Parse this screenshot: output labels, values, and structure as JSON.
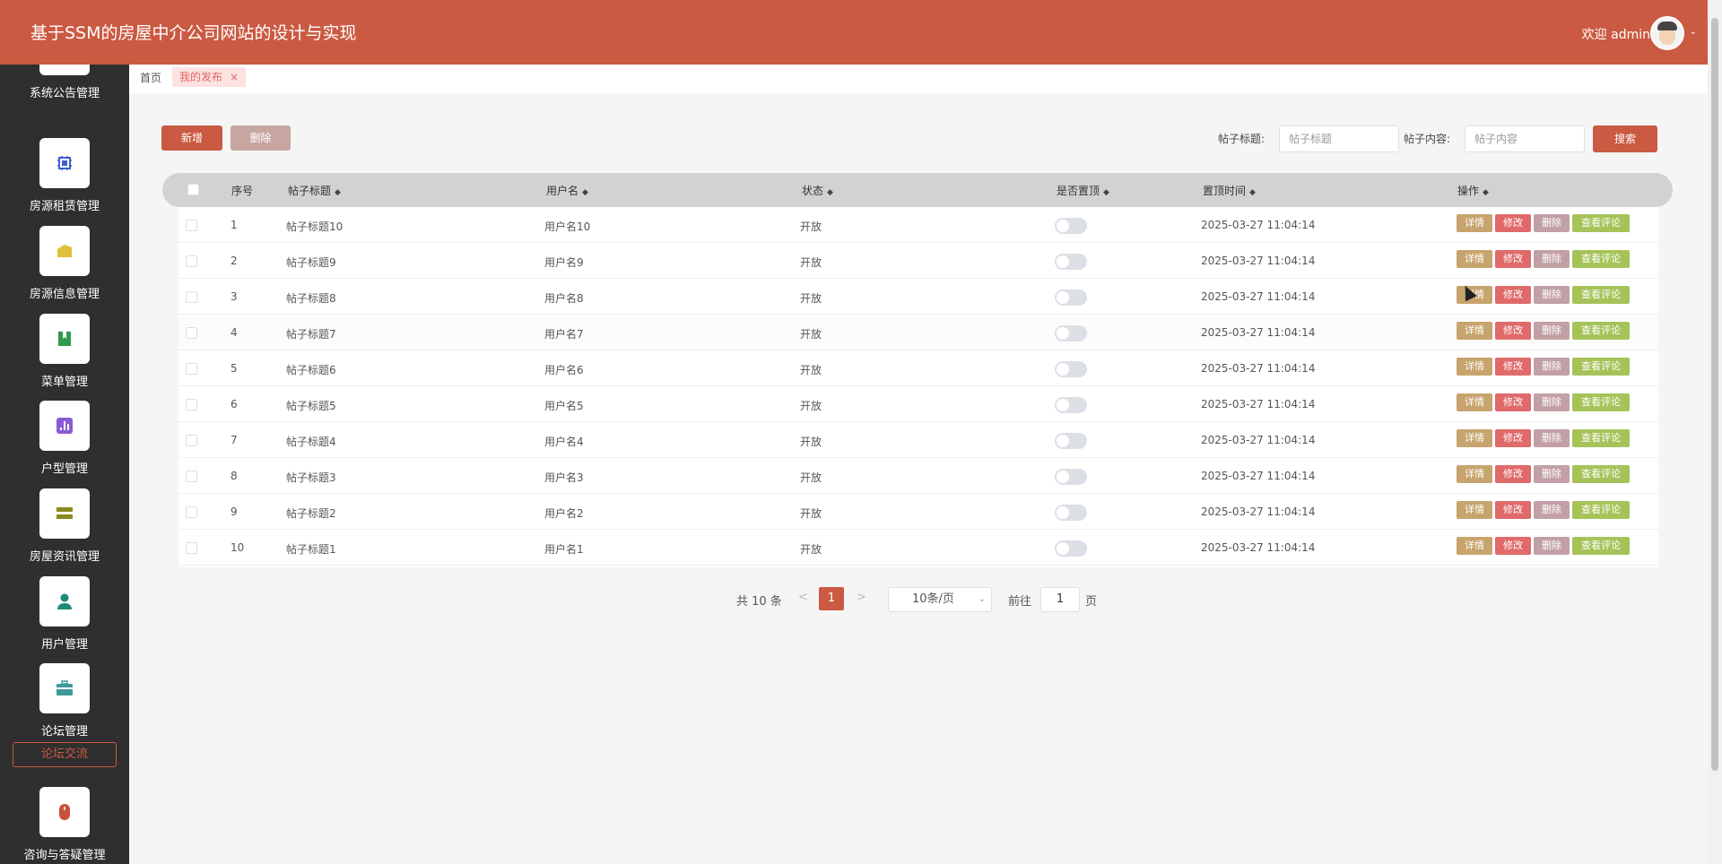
{
  "header": {
    "title": "基于SSM的房屋中介公司网站的设计与实现",
    "welcome": "欢迎 admin",
    "avatar_icon": "user-avatar-icon"
  },
  "sidebar": {
    "items": [
      {
        "label": "系统公告管理",
        "icon": "announcement-icon"
      },
      {
        "label": "房源租赁管理",
        "icon": "chip-icon",
        "color": "#3f5fd1"
      },
      {
        "label": "房源信息管理",
        "icon": "folder-icon",
        "color": "#e0c03a"
      },
      {
        "label": "菜单管理",
        "icon": "bookmark-icon",
        "color": "#2e9a4a"
      },
      {
        "label": "户型管理",
        "icon": "chart-icon",
        "color": "#8a5ad6"
      },
      {
        "label": "房屋资讯管理",
        "icon": "list-icon",
        "color": "#8a8a1e"
      },
      {
        "label": "用户管理",
        "icon": "user-icon",
        "color": "#1e8a7a"
      },
      {
        "label": "论坛管理",
        "icon": "briefcase-icon",
        "color": "#3c9a9a"
      },
      {
        "label": "咨询与答疑管理",
        "icon": "mouse-icon",
        "color": "#c8503a"
      }
    ],
    "submenu_label": "论坛交流"
  },
  "tabs": {
    "home": "首页",
    "active": "我的发布",
    "close": "×"
  },
  "toolbar": {
    "add_label": "新增",
    "delete_label": "删除",
    "title_label": "帖子标题:",
    "title_placeholder": "帖子标题",
    "content_label": "帖子内容:",
    "content_placeholder": "帖子内容",
    "search_label": "搜索"
  },
  "table": {
    "columns": [
      "序号",
      "帖子标题",
      "用户名",
      "状态",
      "是否置顶",
      "置顶时间",
      "操作"
    ],
    "sort_glyph": "◆",
    "actions": {
      "detail": "详情",
      "edit": "修改",
      "delete": "删除",
      "comments": "查看评论"
    },
    "rows": [
      {
        "no": "1",
        "title": "帖子标题10",
        "user": "用户名10",
        "status": "开放",
        "top_time": "2025-03-27 11:04:14"
      },
      {
        "no": "2",
        "title": "帖子标题9",
        "user": "用户名9",
        "status": "开放",
        "top_time": "2025-03-27 11:04:14"
      },
      {
        "no": "3",
        "title": "帖子标题8",
        "user": "用户名8",
        "status": "开放",
        "top_time": "2025-03-27 11:04:14"
      },
      {
        "no": "4",
        "title": "帖子标题7",
        "user": "用户名7",
        "status": "开放",
        "top_time": "2025-03-27 11:04:14"
      },
      {
        "no": "5",
        "title": "帖子标题6",
        "user": "用户名6",
        "status": "开放",
        "top_time": "2025-03-27 11:04:14"
      },
      {
        "no": "6",
        "title": "帖子标题5",
        "user": "用户名5",
        "status": "开放",
        "top_time": "2025-03-27 11:04:14"
      },
      {
        "no": "7",
        "title": "帖子标题4",
        "user": "用户名4",
        "status": "开放",
        "top_time": "2025-03-27 11:04:14"
      },
      {
        "no": "8",
        "title": "帖子标题3",
        "user": "用户名3",
        "status": "开放",
        "top_time": "2025-03-27 11:04:14"
      },
      {
        "no": "9",
        "title": "帖子标题2",
        "user": "用户名2",
        "status": "开放",
        "top_time": "2025-03-27 11:04:14"
      },
      {
        "no": "10",
        "title": "帖子标题1",
        "user": "用户名1",
        "status": "开放",
        "top_time": "2025-03-27 11:04:14"
      }
    ]
  },
  "pagination": {
    "total": "共 10 条",
    "prev": "<",
    "current": "1",
    "next": ">",
    "page_size": "10条/页",
    "goto_label": "前往",
    "goto_value": "1",
    "page_suffix": "页"
  },
  "colors": {
    "accent": "#cb5a42",
    "sidebar_bg": "#2f2f2f"
  }
}
